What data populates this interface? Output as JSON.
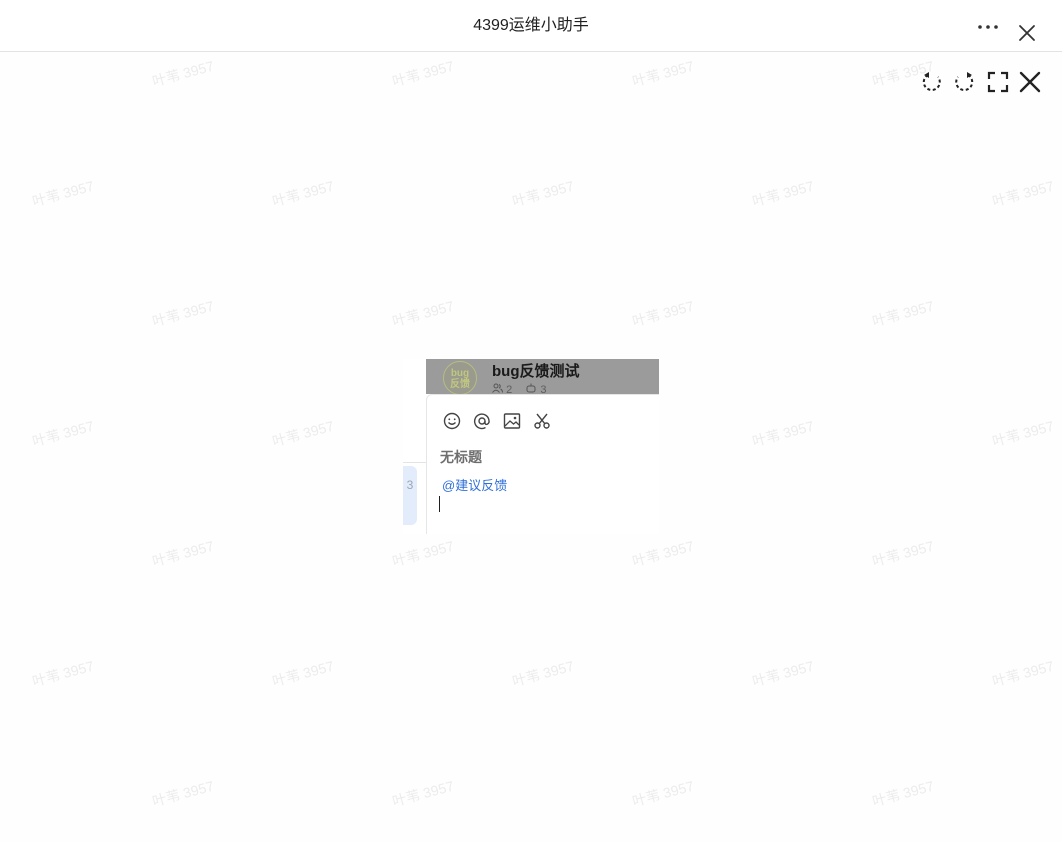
{
  "window": {
    "title": "4399运维小助手",
    "more_icon": "more-horizontal-icon",
    "close_icon": "close-icon"
  },
  "viewer_toolbar": {
    "icons": [
      "rotate-left-icon",
      "rotate-right-icon",
      "fullscreen-icon",
      "close-viewer-icon"
    ]
  },
  "watermark": {
    "text": "叶苇 3957"
  },
  "preview": {
    "group_name": "bug反馈测试",
    "avatar_text": "bug\n反馈",
    "member_count": "2",
    "bot_count": "3",
    "side_badge": "3",
    "editor_tools": [
      "emoji-icon",
      "mention-icon",
      "image-icon",
      "scissors-icon"
    ],
    "draft_title": "无标题",
    "mention_text": "@建议反馈"
  },
  "colors": {
    "accent": "#2f6fd8",
    "header_overlay": "#9b9b9b",
    "selection_chip": "#e2ecfb"
  }
}
